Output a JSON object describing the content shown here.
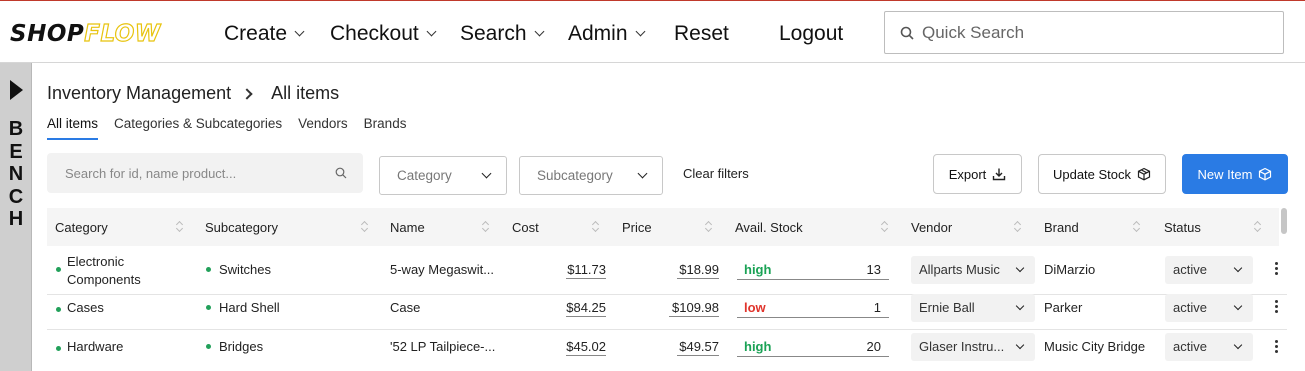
{
  "brand": {
    "part1": "SHOP",
    "part2": "FLOW"
  },
  "nav": [
    {
      "label": "Create",
      "dropdown": true
    },
    {
      "label": "Checkout",
      "dropdown": true
    },
    {
      "label": "Search",
      "dropdown": true
    },
    {
      "label": "Admin",
      "dropdown": true
    },
    {
      "label": "Reset",
      "dropdown": false
    },
    {
      "label": "Logout",
      "dropdown": false
    }
  ],
  "quick_search": {
    "placeholder": "Quick Search",
    "icon": "search-icon"
  },
  "bench": {
    "letters": [
      "B",
      "E",
      "N",
      "C",
      "H"
    ],
    "icon": "play-icon"
  },
  "breadcrumb": {
    "parent": "Inventory Management",
    "current": "All items"
  },
  "tabs": [
    "All items",
    "Categories & Subcategories",
    "Vendors",
    "Brands"
  ],
  "active_tab": "All items",
  "filters": {
    "search_placeholder": "Search for id, name product...",
    "category": "Category",
    "subcategory": "Subcategory",
    "clear": "Clear filters"
  },
  "actions": {
    "export": "Export",
    "update_stock": "Update Stock",
    "new_item": "New Item"
  },
  "columns": [
    "Category",
    "Subcategory",
    "Name",
    "Cost",
    "Price",
    "Avail. Stock",
    "Vendor",
    "Brand",
    "Status"
  ],
  "rows": [
    {
      "category": "Electronic Components",
      "subcategory": "Switches",
      "name": "5-way Megaswit...",
      "cost": "$11.73",
      "price": "$18.99",
      "stock_level": "high",
      "stock_qty": "13",
      "vendor": "Allparts Music",
      "brand": "DiMarzio",
      "status": "active"
    },
    {
      "category": "Cases",
      "subcategory": "Hard Shell",
      "name": "Case",
      "cost": "$84.25",
      "price": "$109.98",
      "stock_level": "low",
      "stock_qty": "1",
      "vendor": "Ernie Ball",
      "brand": "Parker",
      "status": "active"
    },
    {
      "category": "Hardware",
      "subcategory": "Bridges",
      "name": "'52 LP Tailpiece-...",
      "cost": "$45.02",
      "price": "$49.57",
      "stock_level": "high",
      "stock_qty": "20",
      "vendor": "Glaser Instru...",
      "brand": "Music City Bridge",
      "status": "active"
    }
  ],
  "colors": {
    "accent": "#2a7be4",
    "stock_high": "#1aa255",
    "stock_low": "#e0342c",
    "logo_yellow": "#e8c410",
    "status_dot": "#22a05a"
  }
}
